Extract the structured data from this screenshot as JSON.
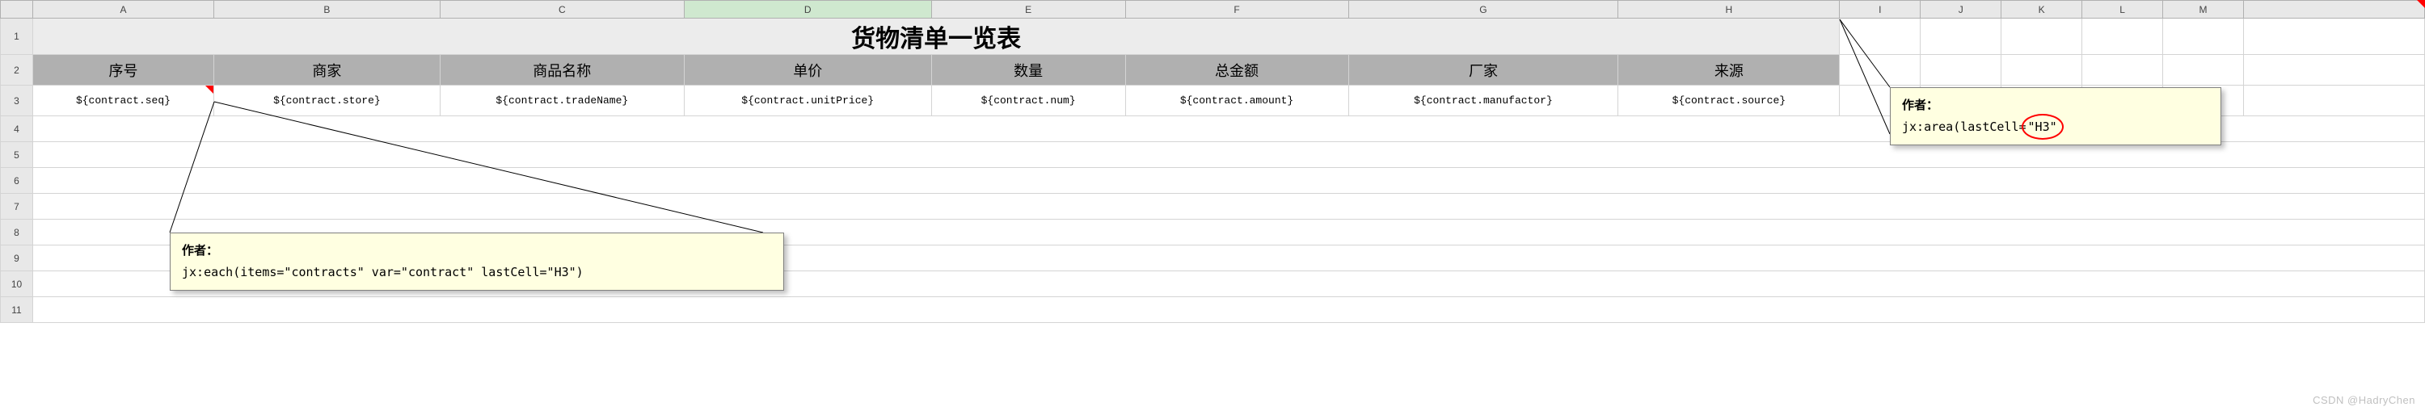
{
  "columns": [
    "A",
    "B",
    "C",
    "D",
    "E",
    "F",
    "G",
    "H",
    "I",
    "J",
    "K",
    "L",
    "M"
  ],
  "active_column_index": 3,
  "row_numbers": [
    1,
    2,
    3,
    4,
    5,
    6,
    7,
    8,
    9,
    10,
    11
  ],
  "title": "货物清单一览表",
  "headers": {
    "A": "序号",
    "B": "商家",
    "C": "商品名称",
    "D": "单价",
    "E": "数量",
    "F": "总金额",
    "G": "厂家",
    "H": "来源"
  },
  "data_row": {
    "A": "${contract.seq}",
    "B": "${contract.store}",
    "C": "${contract.tradeName}",
    "D": "${contract.unitPrice}",
    "E": "${contract.num}",
    "F": "${contract.amount}",
    "G": "${contract.manufactor}",
    "H": "${contract.source}"
  },
  "comment_left": {
    "author": "作者：",
    "body": "jx:each(items=\"contracts\" var=\"contract\" lastCell=\"H3\")"
  },
  "comment_right": {
    "author": "作者：",
    "body_prefix": "jx:area(lastCell=",
    "body_highlight": "\"H3\"",
    "body_suffix": ")"
  },
  "watermark": "CSDN @HadryChen"
}
